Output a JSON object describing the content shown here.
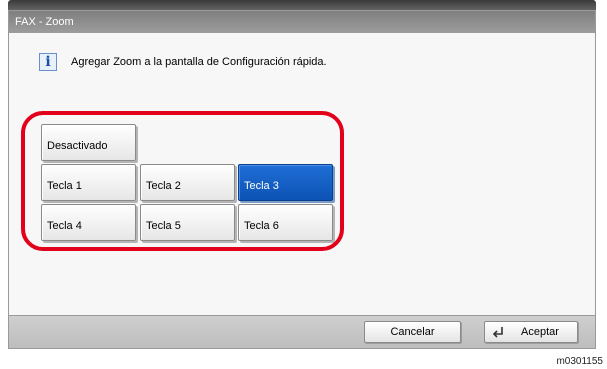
{
  "window": {
    "title": "FAX - Zoom"
  },
  "info": {
    "icon": "info-icon",
    "message": "Agregar Zoom a la pantalla de Configuración rápida."
  },
  "options": {
    "off": "Desactivado",
    "keys": [
      "Tecla 1",
      "Tecla 2",
      "Tecla 3",
      "Tecla 4",
      "Tecla 5",
      "Tecla 6"
    ],
    "selected": "Tecla 3"
  },
  "footer": {
    "cancel_label": "Cancelar",
    "accept_label": "Aceptar",
    "accept_icon": "enter-icon"
  },
  "colors": {
    "highlight": "#e2001a",
    "selected": "#0d52b5"
  },
  "caption": "m0301155"
}
